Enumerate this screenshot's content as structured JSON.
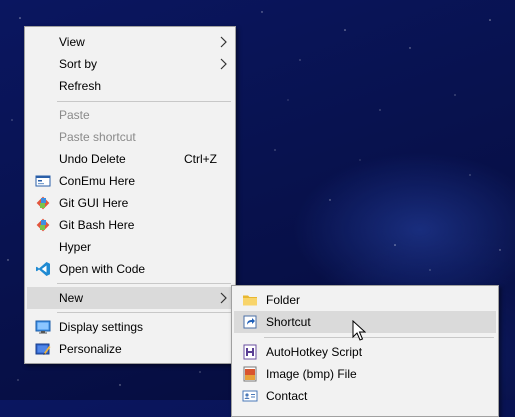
{
  "context_menu": {
    "view": "View",
    "sort_by": "Sort by",
    "refresh": "Refresh",
    "paste": "Paste",
    "paste_shortcut": "Paste shortcut",
    "undo_delete": "Undo Delete",
    "undo_shortcut": "Ctrl+Z",
    "conemu_here": "ConEmu Here",
    "git_gui_here": "Git GUI Here",
    "git_bash_here": "Git Bash Here",
    "hyper": "Hyper",
    "open_with_code": "Open with Code",
    "new": "New",
    "display_settings": "Display settings",
    "personalize": "Personalize"
  },
  "new_submenu": {
    "folder": "Folder",
    "shortcut": "Shortcut",
    "autohotkey_script": "AutoHotkey Script",
    "image_bmp_file": "Image (bmp) File",
    "contact": "Contact"
  },
  "icons": {
    "submenu_arrow": "chevron-right-icon",
    "conemu": "conemu-icon",
    "git": "git-icon",
    "vscode": "vscode-icon",
    "display": "display-icon",
    "personalize": "personalize-icon",
    "folder": "folder-icon",
    "shortcut": "shortcut-icon",
    "autohotkey": "autohotkey-icon",
    "bmp": "bmp-icon",
    "contact": "contact-icon"
  },
  "colors": {
    "menu_background": "#f2f2f2",
    "menu_hover": "#dadada",
    "disabled_text": "#8a8a8a",
    "desktop_background": "#08124f"
  },
  "state": {
    "open_submenu": "New",
    "highlighted_submenu_item": "Shortcut",
    "disabled_items": [
      "Paste",
      "Paste shortcut"
    ]
  }
}
